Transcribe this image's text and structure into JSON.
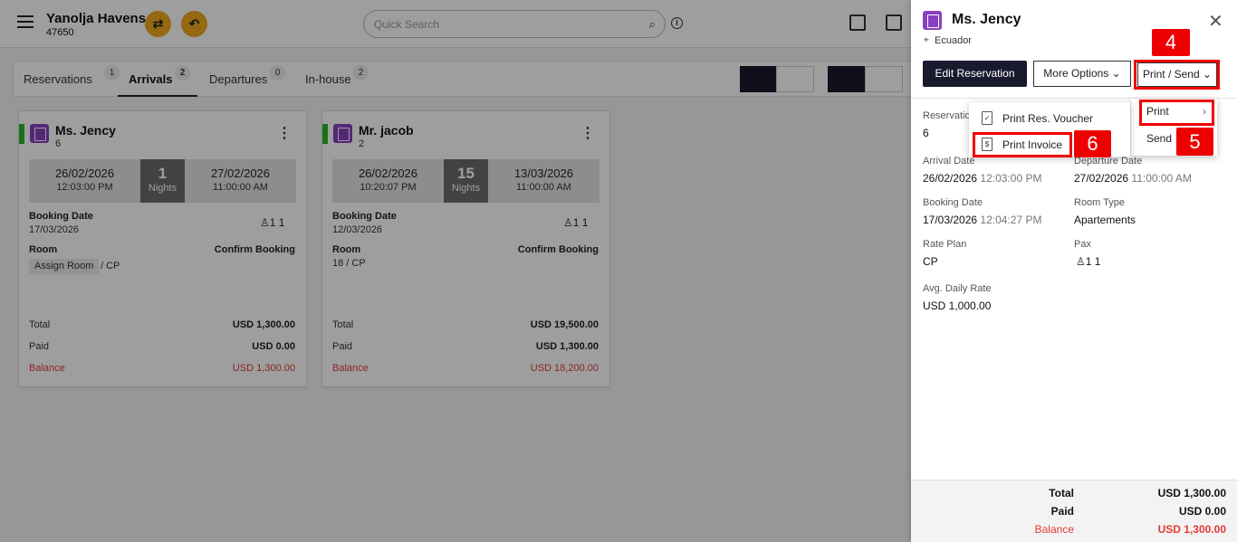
{
  "hotel": {
    "name": "Yanolja Havens",
    "code": "47650"
  },
  "search": {
    "placeholder": "Quick Search"
  },
  "tabs": [
    {
      "label": "Reservations",
      "count": "1"
    },
    {
      "label": "Arrivals",
      "count": "2"
    },
    {
      "label": "Departures",
      "count": "0"
    },
    {
      "label": "In-house",
      "count": "2"
    }
  ],
  "cards": [
    {
      "guest": "Ms. Jency",
      "number": "6",
      "arrival_date": "26/02/2026",
      "arrival_time": "12:03:00 PM",
      "nights": "1",
      "nights_label": "Nights",
      "departure_date": "27/02/2026",
      "departure_time": "11:00:00 AM",
      "booking_label": "Booking Date",
      "booking_date": "17/03/2026",
      "pax": "1    1",
      "room_label": "Room",
      "status": "Confirm Booking",
      "room_chip": "Assign Room",
      "room_value": "/ CP",
      "total_label": "Total",
      "total": "USD 1,300.00",
      "paid_label": "Paid",
      "paid": "USD 0.00",
      "balance_label": "Balance",
      "balance": "USD 1,300.00"
    },
    {
      "guest": "Mr. jacob",
      "number": "2",
      "arrival_date": "26/02/2026",
      "arrival_time": "10:20:07 PM",
      "nights": "15",
      "nights_label": "Nights",
      "departure_date": "13/03/2026",
      "departure_time": "11:00:00 AM",
      "booking_label": "Booking Date",
      "booking_date": "12/03/2026",
      "pax": "1    1",
      "room_label": "Room",
      "status": "Confirm Booking",
      "room_value": "18 / CP",
      "total_label": "Total",
      "total": "USD 19,500.00",
      "paid_label": "Paid",
      "paid": "USD 1,300.00",
      "balance_label": "Balance",
      "balance": "USD 18,200.00"
    }
  ],
  "panel": {
    "guest": "Ms. Jency",
    "country": "Ecuador",
    "edit_btn": "Edit Reservation",
    "more_btn": "More Options",
    "print_btn": "Print / Send",
    "reservation_label": "Reservation",
    "reservation_value": "6",
    "arrival_label": "Arrival Date",
    "arrival_date": "26/02/2026",
    "arrival_time": "12:03:00 PM",
    "departure_label": "Departure Date",
    "departure_date": "27/02/2026",
    "departure_time": "11:00:00 AM",
    "booking_label": "Booking Date",
    "booking_date": "17/03/2026",
    "booking_time": "12:04:27 PM",
    "roomtype_label": "Room Type",
    "roomtype": "Apartements",
    "rateplan_label": "Rate Plan",
    "rateplan": "CP",
    "pax_label": "Pax",
    "pax": "1    1",
    "adr_label": "Avg. Daily Rate",
    "adr": "USD 1,000.00",
    "footer": {
      "total_label": "Total",
      "total": "USD 1,300.00",
      "paid_label": "Paid",
      "paid": "USD 0.00",
      "balance_label": "Balance",
      "balance": "USD 1,300.00"
    }
  },
  "menu_print_send": {
    "print": "Print",
    "send": "Send"
  },
  "menu_print": {
    "voucher": "Print Res. Voucher",
    "invoice": "Print Invoice"
  },
  "steps": {
    "s4": "4",
    "s5": "5",
    "s6": "6"
  },
  "colors": {
    "accent_dark": "#1a1a2e",
    "brand_orange": "#f0a81e",
    "balance_red": "#e53935",
    "highlight_red": "#e00000",
    "status_green": "#2db52d"
  }
}
